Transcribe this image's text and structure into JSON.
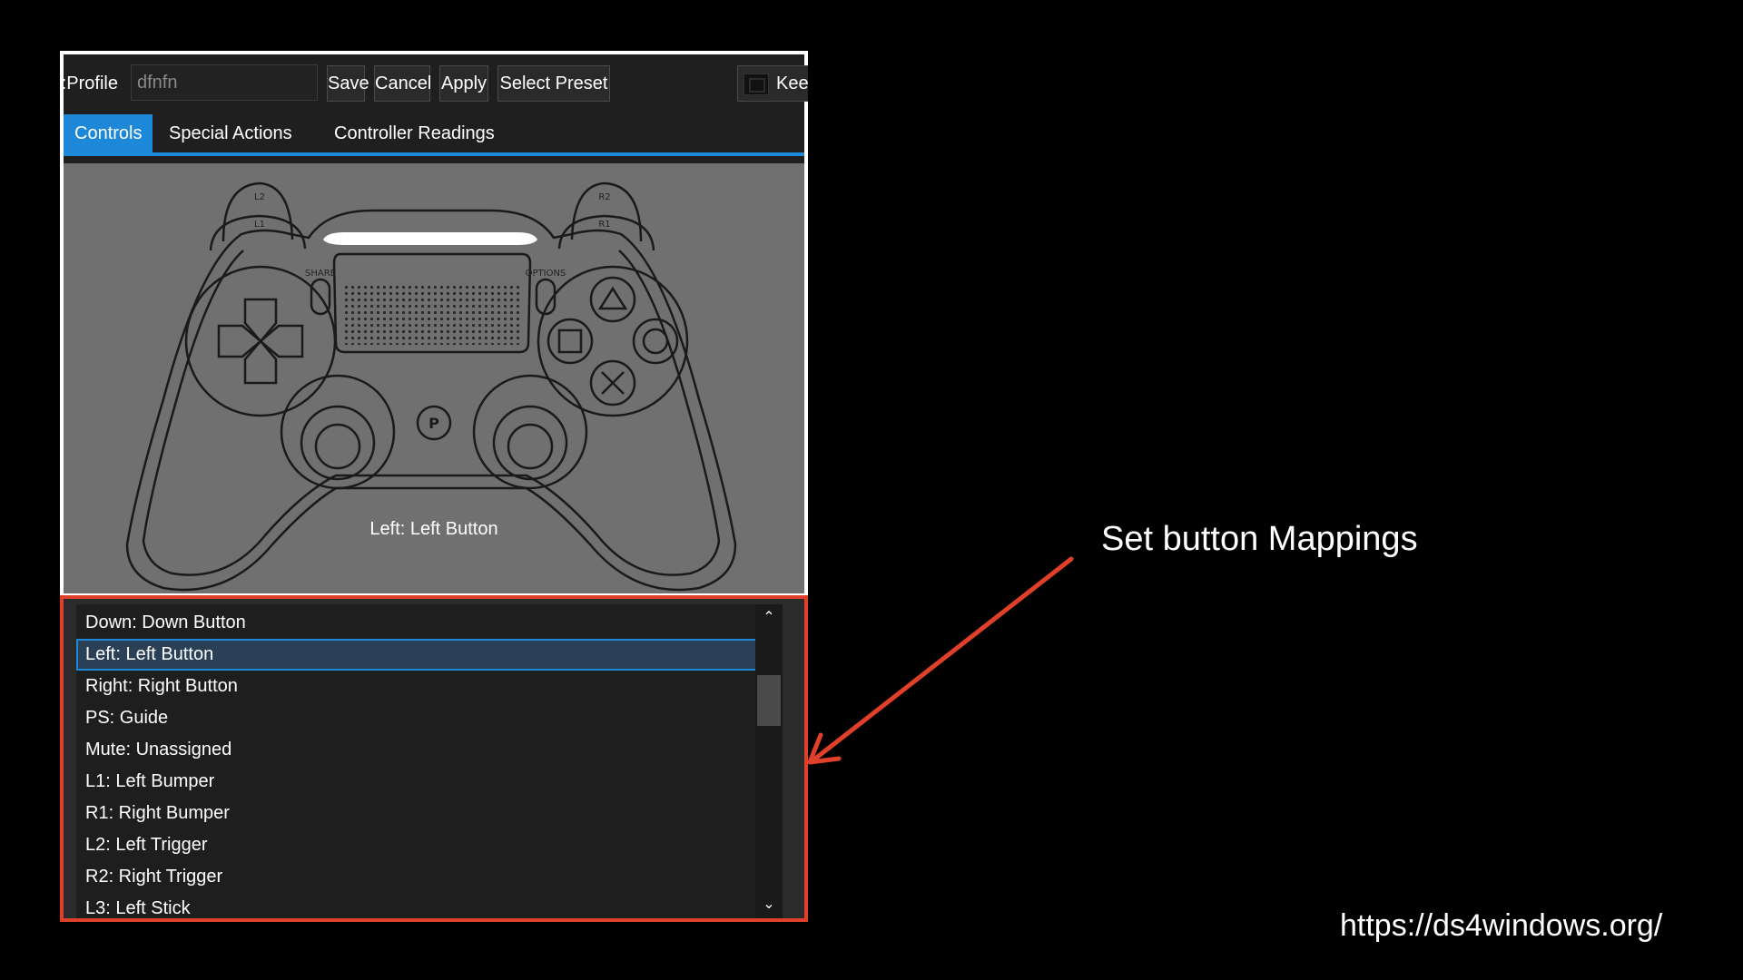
{
  "toolbar": {
    "profile_label": "Profile:",
    "profile_value": "dfnfn",
    "save_label": "Save",
    "cancel_label": "Cancel",
    "apply_label": "Apply",
    "select_preset_label": "Select Preset",
    "keep_label": "Kee"
  },
  "tabs": [
    {
      "label": "Controls",
      "active": true
    },
    {
      "label": "Special Actions",
      "active": false
    },
    {
      "label": "Controller Readings",
      "active": false
    }
  ],
  "controller": {
    "l2": "L2",
    "l1": "L1",
    "r2": "R2",
    "r1": "R1",
    "share": "SHARE",
    "options": "OPTIONS",
    "hovered_mapping": "Left: Left Button"
  },
  "mappings": {
    "items": [
      "Down: Down Button",
      "Left: Left Button",
      "Right: Right Button",
      "PS: Guide",
      "Mute: Unassigned",
      "L1: Left Bumper",
      "R1: Right Bumper",
      "L2: Left Trigger",
      "R2: Right Trigger",
      "L3: Left Stick"
    ],
    "selected_index": 1
  },
  "annotation": {
    "text": "Set button Mappings",
    "color": "#e0402a"
  },
  "footer": {
    "url": "https://ds4windows.org/"
  },
  "colors": {
    "accent": "#1e88d8",
    "highlight_border": "#e0402a"
  }
}
